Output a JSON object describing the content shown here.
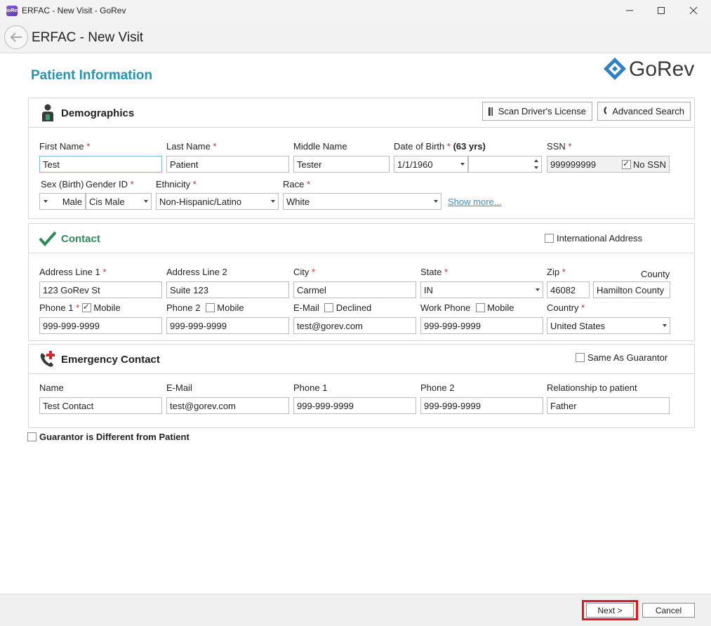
{
  "window": {
    "app_icon_text": "GoRev",
    "title": "ERFAC - New Visit - GoRev"
  },
  "header": {
    "title": "ERFAC - New Visit"
  },
  "page": {
    "title": "Patient Information",
    "logo_text": "GoRev"
  },
  "colors": {
    "accent": "#2396b4",
    "required": "#d3272f",
    "contact_check": "#2e8b57",
    "highlight": "#e01818"
  },
  "demographics": {
    "title": "Demographics",
    "scan_button": "Scan Driver's License",
    "search_button": "Advanced Search",
    "labels": {
      "first_name": "First Name",
      "last_name": "Last Name",
      "middle_name": "Middle Name",
      "dob": "Date of Birth",
      "age": "(63 yrs)",
      "ssn": "SSN",
      "sex": "Sex (Birth)",
      "gender": "Gender ID",
      "ethnicity": "Ethnicity",
      "race": "Race"
    },
    "values": {
      "first_name": "Test",
      "last_name": "Patient",
      "middle_name": "Tester",
      "dob": "1/1/1960",
      "ssn": "999999999",
      "no_ssn": "No SSN",
      "sex": "Male",
      "gender": "Cis Male",
      "ethnicity": "Non-Hispanic/Latino",
      "race": "White"
    },
    "show_more": "Show more..."
  },
  "contact": {
    "title": "Contact",
    "international": "International Address",
    "labels": {
      "address1": "Address Line 1",
      "address2": "Address Line 2",
      "city": "City",
      "state": "State",
      "zip": "Zip",
      "county": "County",
      "phone1": "Phone 1",
      "phone2": "Phone 2",
      "email": "E-Mail",
      "work_phone": "Work Phone",
      "country": "Country",
      "mobile": "Mobile",
      "declined": "Declined"
    },
    "values": {
      "address1": "123 GoRev St",
      "address2": "Suite 123",
      "city": "Carmel",
      "state": "IN",
      "zip": "46082",
      "county": "Hamilton County",
      "phone1": "999-999-9999",
      "phone2": "999-999-9999",
      "email": "test@gorev.com",
      "work_phone": "999-999-9999",
      "country": "United States"
    }
  },
  "emergency": {
    "title": "Emergency Contact",
    "same_as_guarantor": "Same As Guarantor",
    "labels": {
      "name": "Name",
      "email": "E-Mail",
      "phone1": "Phone 1",
      "phone2": "Phone 2",
      "relationship": "Relationship to patient"
    },
    "values": {
      "name": "Test Contact",
      "email": "test@gorev.com",
      "phone1": "999-999-9999",
      "phone2": "999-999-9999",
      "relationship": "Father"
    }
  },
  "guarantor_diff": "Guarantor is Different from Patient",
  "footer": {
    "next": "Next >",
    "cancel": "Cancel"
  }
}
